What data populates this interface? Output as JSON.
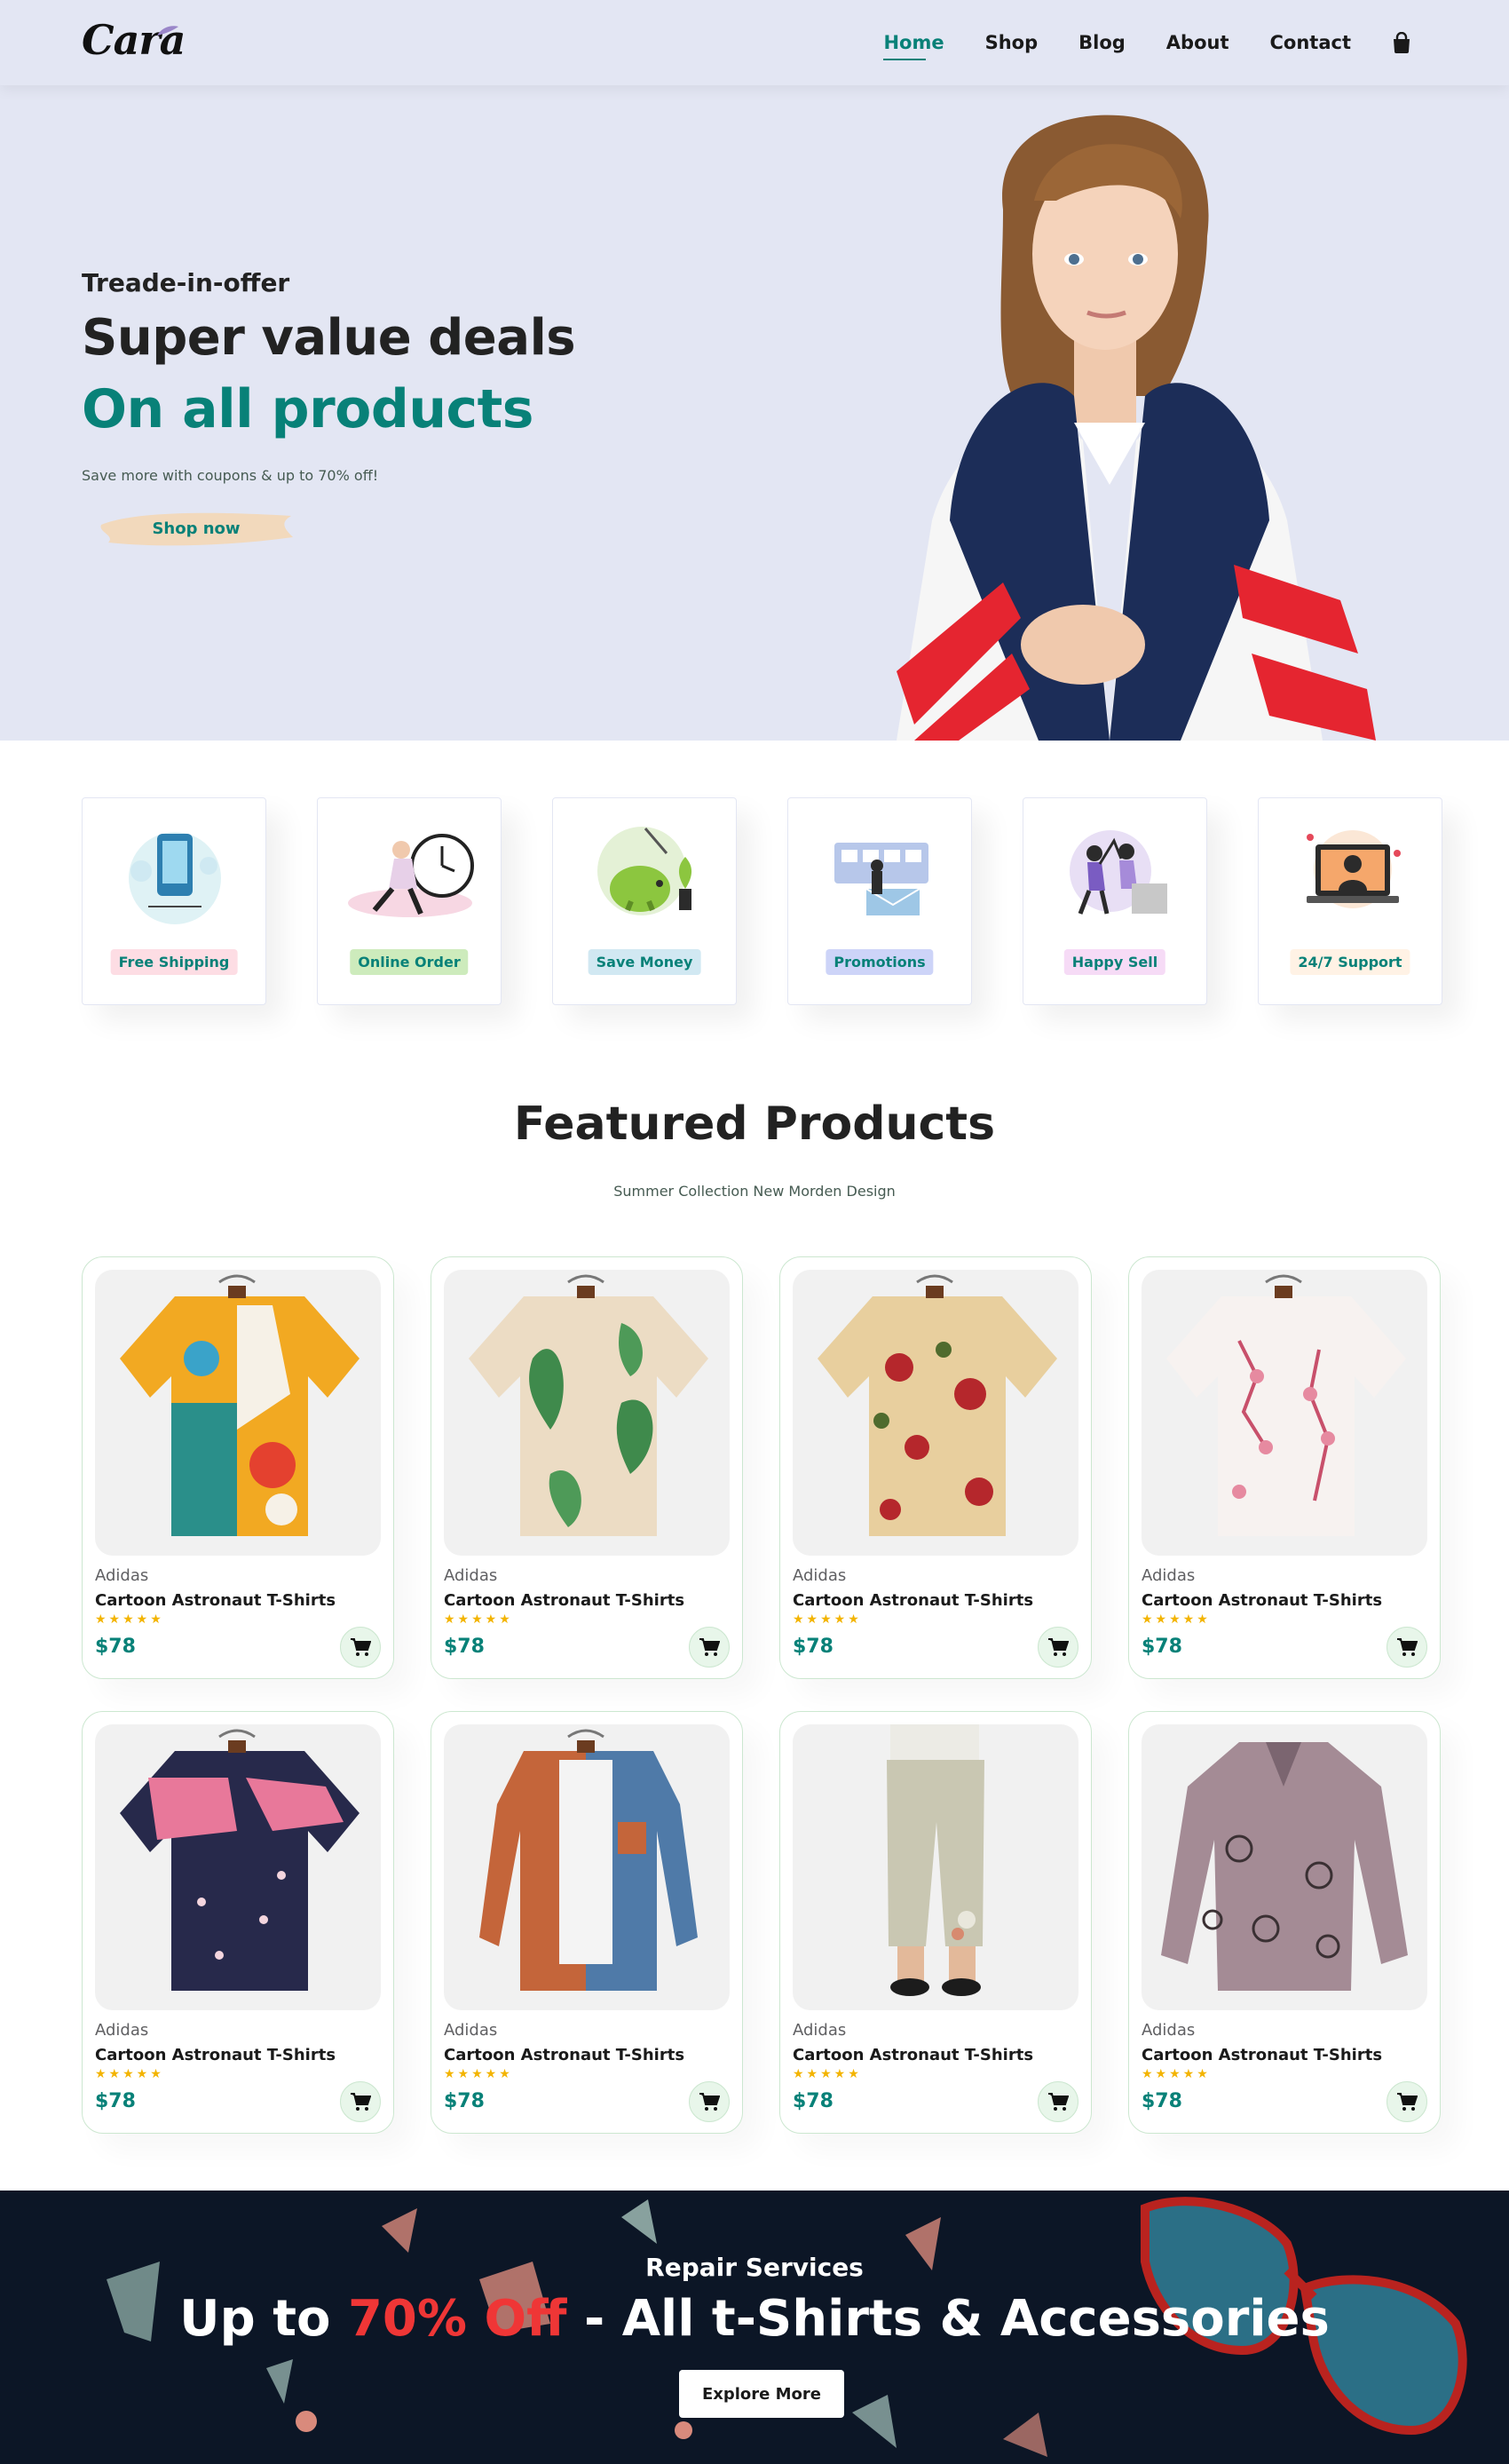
{
  "brand": {
    "logo_text": "Cara"
  },
  "nav": {
    "items": [
      {
        "label": "Home",
        "active": true
      },
      {
        "label": "Shop",
        "active": false
      },
      {
        "label": "Blog",
        "active": false
      },
      {
        "label": "About",
        "active": false
      },
      {
        "label": "Contact",
        "active": false
      }
    ],
    "cart_icon": "shopping-bag-icon"
  },
  "hero": {
    "eyebrow": "Treade-in-offer",
    "title_line1": "Super value deals",
    "title_line2": "On all products",
    "subtitle": "Save more with coupons & up to 70% off!",
    "cta_label": "Shop now"
  },
  "features": [
    {
      "label": "Free Shipping",
      "label_bg": "#fddde4"
    },
    {
      "label": "Online Order",
      "label_bg": "#cdebbc"
    },
    {
      "label": "Save Money",
      "label_bg": "#d1e8f2"
    },
    {
      "label": "Promotions",
      "label_bg": "#cdd4f8"
    },
    {
      "label": "Happy Sell",
      "label_bg": "#f6dbf6"
    },
    {
      "label": "24/7 Support",
      "label_bg": "#fff2e5"
    }
  ],
  "featured": {
    "title": "Featured Products",
    "subtitle": "Summer Collection New Morden Design",
    "products": [
      {
        "brand": "Adidas",
        "name": "Cartoon Astronaut T-Shirts",
        "price": "$78",
        "stars": "★★★★★",
        "rating": 5
      },
      {
        "brand": "Adidas",
        "name": "Cartoon Astronaut T-Shirts",
        "price": "$78",
        "stars": "★★★★★",
        "rating": 5
      },
      {
        "brand": "Adidas",
        "name": "Cartoon Astronaut T-Shirts",
        "price": "$78",
        "stars": "★★★★★",
        "rating": 5
      },
      {
        "brand": "Adidas",
        "name": "Cartoon Astronaut T-Shirts",
        "price": "$78",
        "stars": "★★★★★",
        "rating": 5
      },
      {
        "brand": "Adidas",
        "name": "Cartoon Astronaut T-Shirts",
        "price": "$78",
        "stars": "★★★★★",
        "rating": 5
      },
      {
        "brand": "Adidas",
        "name": "Cartoon Astronaut T-Shirts",
        "price": "$78",
        "stars": "★★★★★",
        "rating": 5
      },
      {
        "brand": "Adidas",
        "name": "Cartoon Astronaut T-Shirts",
        "price": "$78",
        "stars": "★★★★★",
        "rating": 5
      },
      {
        "brand": "Adidas",
        "name": "Cartoon Astronaut T-Shirts",
        "price": "$78",
        "stars": "★★★★★",
        "rating": 5
      }
    ]
  },
  "banner": {
    "eyebrow": "Repair Services",
    "headline_prefix": "Up to",
    "headline_highlight": "70% Off",
    "headline_suffix": "- All t-Shirts & Accessories",
    "cta_label": "Explore More"
  },
  "colors": {
    "accent": "#088178",
    "hero_bg": "#e3e6f3",
    "banner_bg": "#0c1626",
    "highlight_red": "#ef3636",
    "star": "#f3b400"
  }
}
